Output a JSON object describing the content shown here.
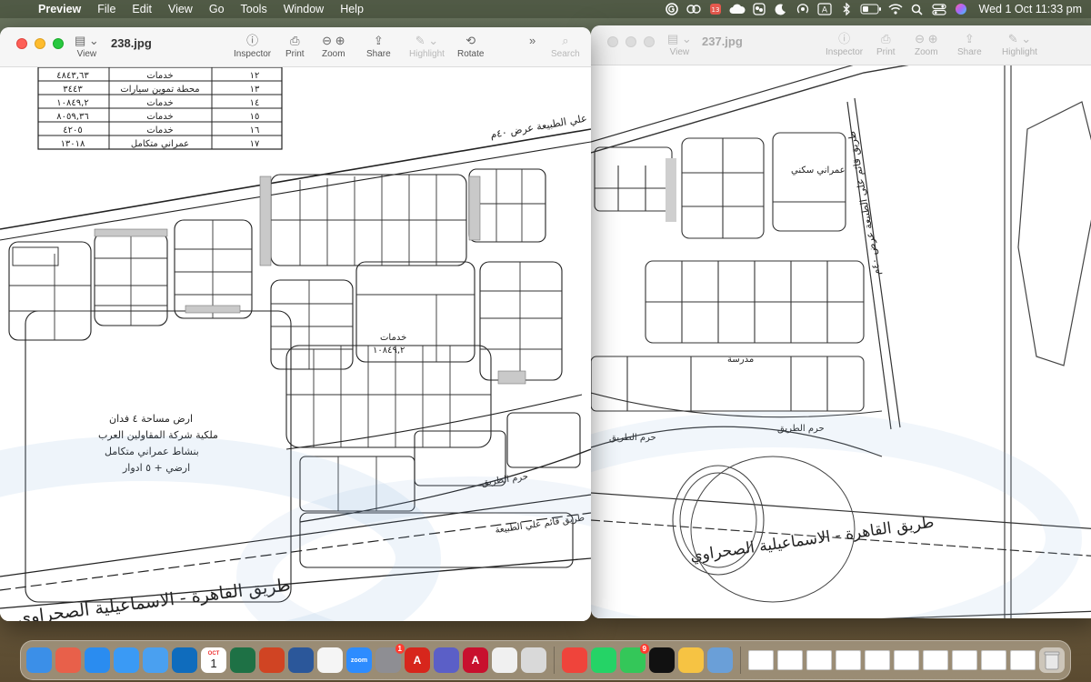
{
  "menubar": {
    "app_name": "Preview",
    "menus": [
      "File",
      "Edit",
      "View",
      "Go",
      "Tools",
      "Window",
      "Help"
    ],
    "status_icons": [
      "grammarly-icon",
      "creative-cloud-icon",
      "notification-app-icon",
      "cloud-icon",
      "wechat-icon",
      "moon-icon",
      "airplay-icon",
      "input-source-icon",
      "bluetooth-icon",
      "battery-icon",
      "wifi-icon",
      "spotlight-icon",
      "control-center-icon",
      "siri-icon"
    ],
    "input_source": "A",
    "clock": "Wed 1 Oct  11:33 pm"
  },
  "front_window": {
    "title": "238.jpg",
    "tools": {
      "view": "View",
      "inspector": "Inspector",
      "print": "Print",
      "zoom": "Zoom",
      "share": "Share",
      "highlight": "Highlight",
      "rotate": "Rotate",
      "search": "Search"
    },
    "table_rows": [
      {
        "num": "١٢",
        "use": "خدمات",
        "area": "٤٨٤٣,٦٣"
      },
      {
        "num": "١٣",
        "use": "محطة تموين سيارات",
        "area": "٣٤٤٣"
      },
      {
        "num": "١٤",
        "use": "خدمات",
        "area": "١٠٨٤٩,٢"
      },
      {
        "num": "١٥",
        "use": "خدمات",
        "area": "٨٠٥٩,٣٦"
      },
      {
        "num": "١٦",
        "use": "خدمات",
        "area": "٤٢٠٥"
      },
      {
        "num": "١٧",
        "use": "عمراني متكامل",
        "area": "١٣٠١٨"
      }
    ],
    "map_labels": {
      "road_top": "طريق قائم علي الطبيعة عرض ٤٠م",
      "big_plot_line1": "ارض مساحة ٤ فدان",
      "big_plot_line2": "ملكية شركة المقاولين العرب",
      "big_plot_line3": "بنشاط عمراني متكامل",
      "big_plot_line4": "ارضي + ٥ ادوار",
      "road_reserve": "حرم الطريق",
      "highway": "طريق القاهرة - الاسماعيلية الصحراوي",
      "side_road": "طريق قائم علي الطبيعة",
      "services_plot": "خدمات",
      "services_area": "١٠٨٤٩,٢"
    }
  },
  "back_window": {
    "title": "237.jpg",
    "tools": {
      "view": "View",
      "inspector": "Inspector",
      "print": "Print",
      "zoom": "Zoom",
      "share": "Share",
      "highlight": "Highlight"
    },
    "map_labels": {
      "residential": "عمراني سكني",
      "school": "مدرسة",
      "road_reserve_1": "حرم الطريق",
      "road_reserve_2": "حرم الطريق",
      "highway": "طريق القاهرة - الاسماعيلية الصحراوي",
      "side_road": "طريق قائم علي الطبيعة عرض ٤٠م"
    }
  },
  "dock": {
    "apps": [
      {
        "name": "finder",
        "color": "#3b8fe8"
      },
      {
        "name": "launchpad",
        "color": "#e8604a"
      },
      {
        "name": "safari",
        "color": "#2a8cf0"
      },
      {
        "name": "mail",
        "color": "#3a9af5"
      },
      {
        "name": "testflight",
        "color": "#4aa0f0"
      },
      {
        "name": "outlook",
        "color": "#0f6cbd"
      },
      {
        "name": "calendar",
        "color": "#ffffff"
      },
      {
        "name": "excel",
        "color": "#1e7145"
      },
      {
        "name": "powerpoint",
        "color": "#d04423"
      },
      {
        "name": "word",
        "color": "#2b579a"
      },
      {
        "name": "reminders",
        "color": "#f5f5f5"
      },
      {
        "name": "zoom",
        "color": "#2d8cff"
      },
      {
        "name": "system-settings",
        "color": "#8e8e93"
      },
      {
        "name": "acrobat",
        "color": "#d7261c"
      },
      {
        "name": "teams",
        "color": "#5b5fc7"
      },
      {
        "name": "autocad",
        "color": "#c8102e"
      },
      {
        "name": "freeform",
        "color": "#f0f0f0"
      },
      {
        "name": "iphone-mirroring",
        "color": "#d9d9d9"
      },
      {
        "name": "anydesk",
        "color": "#ef443b"
      },
      {
        "name": "whatsapp",
        "color": "#25d366"
      },
      {
        "name": "messages",
        "color": "#34c759"
      },
      {
        "name": "app-store-connect",
        "color": "#111111"
      },
      {
        "name": "notes",
        "color": "#f6c343"
      },
      {
        "name": "preview",
        "color": "#6a9fd8"
      }
    ],
    "calendar_month": "OCT",
    "calendar_day": "1",
    "settings_badge": "1",
    "messages_badge": "9",
    "acrobat_label": "A",
    "autocad_label": "A",
    "zoom_label": "zoom"
  }
}
